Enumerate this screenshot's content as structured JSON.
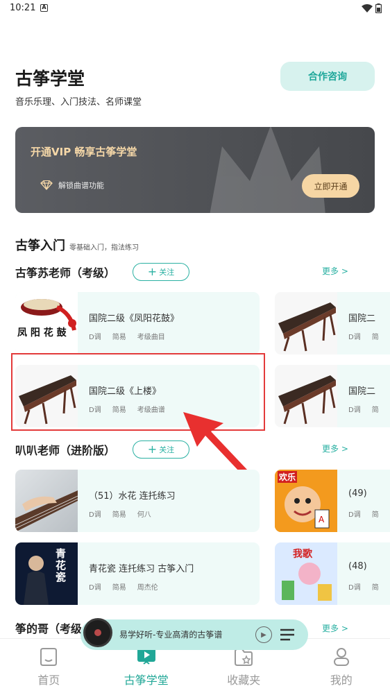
{
  "status": {
    "time": "10:21",
    "app_icon": "A"
  },
  "header": {
    "title": "古筝学堂",
    "subtitle": "音乐乐理、入门技法、名师课堂",
    "consult_label": "合作咨询"
  },
  "vip": {
    "title": "开通VIP 畅享古筝学堂",
    "feature": "解锁曲谱功能",
    "button": "立即开通",
    "accent": "#f6d6a4"
  },
  "section": {
    "title": "古筝入门",
    "subtitle": "零基础入门，指法练习"
  },
  "teachers": [
    {
      "name": "古筝苏老师（考级）",
      "follow": "关注",
      "more": "更多 >",
      "cards": [
        {
          "title": "国院二级《凤阳花鼓》",
          "meta": [
            "D调",
            "简易",
            "考级曲目"
          ]
        },
        {
          "title": "国院二",
          "meta": [
            "D调",
            "简"
          ]
        },
        {
          "title": "国院二级《上楼》",
          "meta": [
            "D调",
            "简易",
            "考级曲谱"
          ]
        },
        {
          "title": "国院二",
          "meta": [
            "D调",
            "简"
          ]
        }
      ]
    },
    {
      "name": "叭叭老师（进阶版）",
      "follow": "关注",
      "more": "更多 >",
      "cards": [
        {
          "title": "（51）水花 连托练习",
          "meta": [
            "D调",
            "简易",
            "何八"
          ]
        },
        {
          "title": "(49)",
          "meta": [
            "D调",
            "简"
          ]
        },
        {
          "title": "青花瓷 连托练习 古筝入门",
          "meta": [
            "D调",
            "简易",
            "周杰伦"
          ]
        },
        {
          "title": "(48)",
          "meta": [
            "D调",
            "简"
          ]
        }
      ]
    },
    {
      "name": "筝的哥（考级",
      "more": "更多 >"
    }
  ],
  "image_text": {
    "fengyang": "凤 阳 花 鼓",
    "qinghuaci": "青\n花\n瓷",
    "huanle": "欢乐",
    "song": "我歌"
  },
  "player": {
    "title": "易学好听-专业高清的古筝谱"
  },
  "nav": [
    {
      "label": "首页",
      "icon": "home-icon"
    },
    {
      "label": "古筝学堂",
      "icon": "play-screen-icon"
    },
    {
      "label": "收藏夹",
      "icon": "star-folder-icon"
    },
    {
      "label": "我的",
      "icon": "person-icon"
    }
  ]
}
